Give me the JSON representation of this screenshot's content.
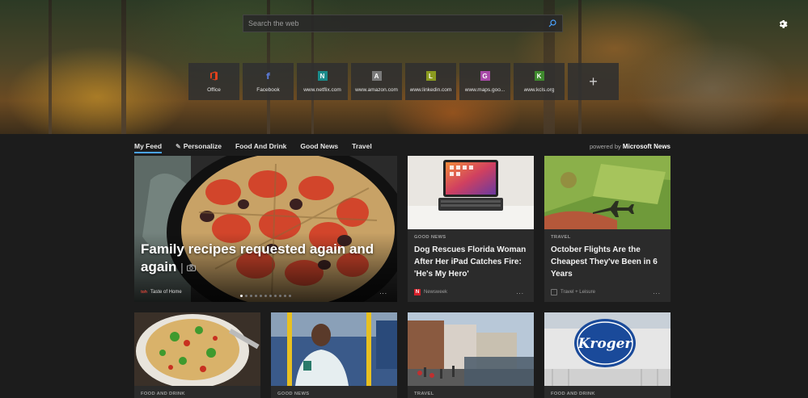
{
  "search": {
    "placeholder": "Search the web"
  },
  "tiles": [
    {
      "label": "Office",
      "icon": "office-icon",
      "color": "#e3411c",
      "glyph": ""
    },
    {
      "label": "Facebook",
      "icon": "facebook-icon",
      "color": "#3b5ba8",
      "glyph": "f"
    },
    {
      "label": "www.netflix.com",
      "icon": "letter-n-icon",
      "color": "#1a8a8a",
      "glyph": "N"
    },
    {
      "label": "www.amazon.com",
      "icon": "letter-a-icon",
      "color": "#7a7a7a",
      "glyph": "A"
    },
    {
      "label": "www.linkedin.com",
      "icon": "letter-l-icon",
      "color": "#8a9a1f",
      "glyph": "L"
    },
    {
      "label": "www.maps.goo...",
      "icon": "letter-g-icon",
      "color": "#a84aa8",
      "glyph": "G"
    },
    {
      "label": "www.kcls.org",
      "icon": "letter-k-icon",
      "color": "#3f8a2e",
      "glyph": "K"
    }
  ],
  "add_tile": {
    "glyph": "+"
  },
  "nav": {
    "my_feed": "My Feed",
    "personalize": "Personalize",
    "food_and_drink": "Food And Drink",
    "good_news": "Good News",
    "travel": "Travel",
    "powered_prefix": "powered by",
    "powered_brand": "Microsoft News"
  },
  "hero_story": {
    "title": "Family recipes requested again and again",
    "source": "Taste of Home",
    "source_logo": "toh",
    "more": "..."
  },
  "cards": [
    {
      "category": "GOOD NEWS",
      "title": "Dog Rescues Florida Woman After Her iPad Catches Fire: 'He's My Hero'",
      "source": "Newsweek",
      "logo": "N",
      "more": "..."
    },
    {
      "category": "TRAVEL",
      "title": "October Flights Are the Cheapest They've Been in 6 Years",
      "source": "Travel + Leisure",
      "logo": "",
      "more": "..."
    }
  ],
  "bottom_cards": [
    {
      "category": "FOOD AND DRINK"
    },
    {
      "category": "GOOD NEWS"
    },
    {
      "category": "TRAVEL"
    },
    {
      "category": "FOOD AND DRINK"
    }
  ],
  "bottom_images": {
    "kroger_text": "Kroger"
  },
  "colors": {
    "accent": "#4aa3ff",
    "card_bg": "#2b2b2b",
    "page_bg": "#1c1c1c",
    "newsweek_red": "#d6202a",
    "office_orange": "#e3411c"
  }
}
